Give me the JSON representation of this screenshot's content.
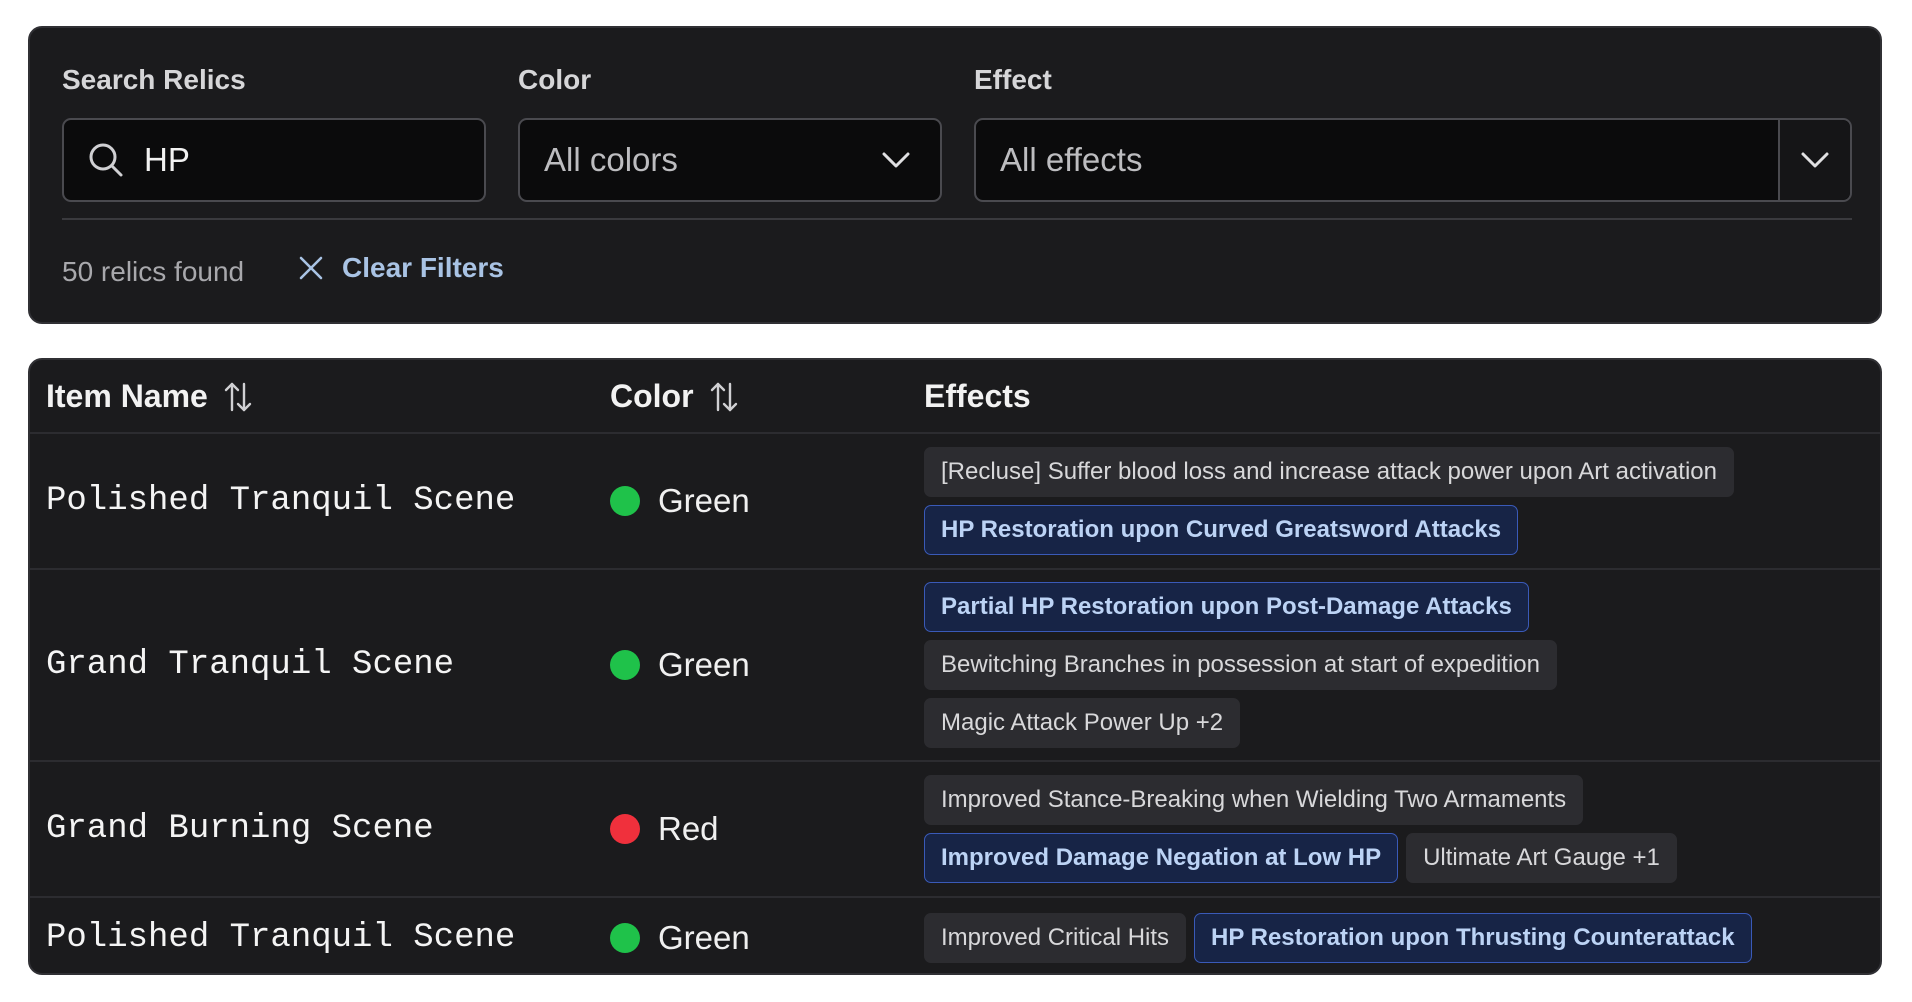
{
  "filters": {
    "search_label": "Search Relics",
    "search_value": "HP",
    "color_label": "Color",
    "color_value": "All colors",
    "effect_label": "Effect",
    "effect_value": "All effects",
    "result_count": "50 relics found",
    "clear_label": "Clear Filters"
  },
  "table": {
    "headers": {
      "name": "Item Name",
      "color": "Color",
      "effects": "Effects"
    },
    "rows": [
      {
        "name": "Polished Tranquil Scene",
        "color": "Green",
        "dot_color": "#1fc24a",
        "effect_lines": [
          [
            {
              "text": "[Recluse] Suffer blood loss and increase attack power upon Art activation",
              "match": false
            }
          ],
          [
            {
              "text": "HP Restoration upon Curved Greatsword Attacks",
              "match": true
            }
          ]
        ]
      },
      {
        "name": "Grand Tranquil Scene",
        "color": "Green",
        "dot_color": "#1fc24a",
        "effect_lines": [
          [
            {
              "text": "Partial HP Restoration upon Post-Damage Attacks",
              "match": true
            }
          ],
          [
            {
              "text": "Bewitching Branches in possession at start of expedition",
              "match": false
            }
          ],
          [
            {
              "text": "Magic Attack Power Up +2",
              "match": false
            }
          ]
        ]
      },
      {
        "name": "Grand Burning Scene",
        "color": "Red",
        "dot_color": "#f0303c",
        "effect_lines": [
          [
            {
              "text": "Improved Stance-Breaking when Wielding Two Armaments",
              "match": false
            }
          ],
          [
            {
              "text": "Improved Damage Negation at Low HP",
              "match": true
            },
            {
              "text": "Ultimate Art Gauge +1",
              "match": false
            }
          ]
        ]
      },
      {
        "name": "Polished Tranquil Scene",
        "color": "Green",
        "dot_color": "#1fc24a",
        "effect_lines": [
          [
            {
              "text": "Improved Critical Hits",
              "match": false
            },
            {
              "text": "HP Restoration upon Thrusting Counterattack",
              "match": true
            }
          ]
        ]
      }
    ]
  }
}
